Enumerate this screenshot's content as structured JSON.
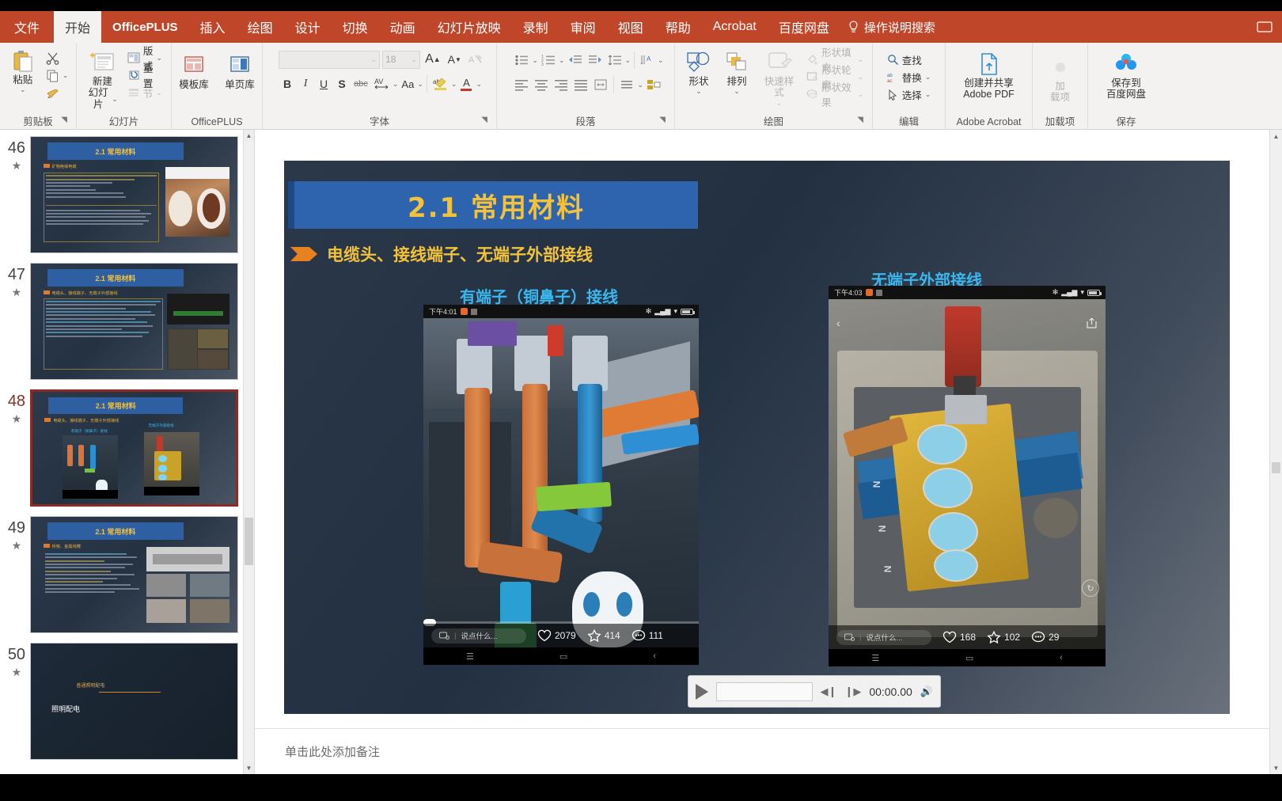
{
  "tabs": [
    {
      "label": "文件",
      "active": false,
      "kind": "file"
    },
    {
      "label": "开始",
      "active": true,
      "kind": "normal"
    },
    {
      "label": "OfficePLUS",
      "active": false,
      "kind": "plus"
    },
    {
      "label": "插入",
      "active": false,
      "kind": "normal"
    },
    {
      "label": "绘图",
      "active": false,
      "kind": "normal"
    },
    {
      "label": "设计",
      "active": false,
      "kind": "normal"
    },
    {
      "label": "切换",
      "active": false,
      "kind": "normal"
    },
    {
      "label": "动画",
      "active": false,
      "kind": "normal"
    },
    {
      "label": "幻灯片放映",
      "active": false,
      "kind": "normal"
    },
    {
      "label": "录制",
      "active": false,
      "kind": "normal"
    },
    {
      "label": "审阅",
      "active": false,
      "kind": "normal"
    },
    {
      "label": "视图",
      "active": false,
      "kind": "normal"
    },
    {
      "label": "帮助",
      "active": false,
      "kind": "normal"
    },
    {
      "label": "Acrobat",
      "active": false,
      "kind": "normal"
    },
    {
      "label": "百度网盘",
      "active": false,
      "kind": "normal"
    }
  ],
  "tellme": {
    "label": "操作说明搜索",
    "icon": "lightbulb-icon"
  },
  "ribbon": {
    "clipboard": {
      "label": "剪贴板",
      "paste": "粘贴",
      "cut_icon": "scissors-icon",
      "copy_icon": "copy-icon",
      "format_painter_icon": "format-painter-icon"
    },
    "slides": {
      "label": "幻灯片",
      "new_slide": "新建\n幻灯片",
      "new_slide_l1": "新建",
      "new_slide_l2": "幻灯片",
      "layout": "版式",
      "reset": "重置",
      "section": "节"
    },
    "officeplus": {
      "label": "OfficePLUS",
      "template_library": "模板库",
      "single_page_library": "单页库"
    },
    "font": {
      "label": "字体",
      "name_value": "",
      "size_value": "18",
      "grow": "A",
      "shrink": "A",
      "clear_format_icon": "clear-format-icon",
      "bold": "B",
      "italic": "I",
      "underline": "U",
      "shadow": "S",
      "strike": "abc",
      "spacing": "AV",
      "case": "Aa",
      "highlight": "ab",
      "color": "A"
    },
    "paragraph": {
      "label": "段落",
      "bullets_icon": "bulleted-list-icon",
      "numbering_icon": "numbered-list-icon",
      "dec_indent_icon": "decrease-indent-icon",
      "inc_indent_icon": "increase-indent-icon",
      "line_spacing_icon": "line-spacing-icon",
      "align_left_icon": "align-left-icon",
      "align_center_icon": "align-center-icon",
      "align_right_icon": "align-right-icon",
      "justify_icon": "justify-icon",
      "columns_icon": "columns-icon",
      "text_direction_icon": "text-direction-icon",
      "align_text_icon": "align-text-icon",
      "smartart_icon": "convert-to-smartart-icon"
    },
    "drawing": {
      "label": "绘图",
      "shapes": "形状",
      "arrange": "排列",
      "quick_styles": "快速样式",
      "shape_fill": "形状填充",
      "shape_outline": "形状轮廓",
      "shape_effects": "形状效果"
    },
    "editing": {
      "label": "编辑",
      "find": "查找",
      "replace": "替换",
      "select": "选择"
    },
    "acrobat": {
      "label": "Adobe Acrobat",
      "create_share_l1": "创建并共享",
      "create_share_l2": "Adobe PDF"
    },
    "addins": {
      "label": "加载项",
      "item_l1": "加",
      "item_l2": "载项"
    },
    "save": {
      "label": "保存",
      "baidu_l1": "保存到",
      "baidu_l2": "百度网盘"
    }
  },
  "thumbnails": [
    {
      "number": "46",
      "star": "★",
      "title": "2.1 常用材料",
      "bullet": "矿物绝缘电缆",
      "selected": false
    },
    {
      "number": "47",
      "star": "★",
      "title": "2.1 常用材料",
      "bullet": "电缆头、接线端子、无端子外部接线",
      "selected": false
    },
    {
      "number": "48",
      "star": "★",
      "title": "2.1 常用材料",
      "bullet": "电缆头、接线端子、无端子外部接线",
      "selected": true
    },
    {
      "number": "49",
      "star": "★",
      "title": "2.1 常用材料",
      "bullet": "桥架、金属线槽",
      "selected": false
    },
    {
      "number": "50",
      "star": "★",
      "title": "照明配电",
      "bullet": "普通照明配电",
      "selected": false
    }
  ],
  "slide": {
    "title": "2.1 常用材料",
    "bullet": "电缆头、接线端子、无端子外部接线",
    "caption_left": "有端子（铜鼻子）接线",
    "caption_right": "无端子外部接线",
    "video_left": {
      "time": "下午4:01",
      "likes": "2079",
      "stars": "414",
      "comments": "111",
      "comment_placeholder": "说点什么..."
    },
    "video_right": {
      "time": "下午4:03",
      "likes": "168",
      "stars": "102",
      "comments": "29",
      "comment_placeholder": "说点什么..."
    }
  },
  "player": {
    "play_icon": "play-icon",
    "back_icon": "step-back-icon",
    "forward_icon": "step-forward-icon",
    "time": "00:00.00",
    "volume_icon": "volume-icon"
  },
  "notes": {
    "placeholder": "单击此处添加备注"
  },
  "colors": {
    "ribbon": "#c0462a",
    "title_blue": "#2e64ad",
    "title_gold": "#f3c13a",
    "caption_cyan": "#3ab7ef",
    "selection": "#8b2b25"
  }
}
